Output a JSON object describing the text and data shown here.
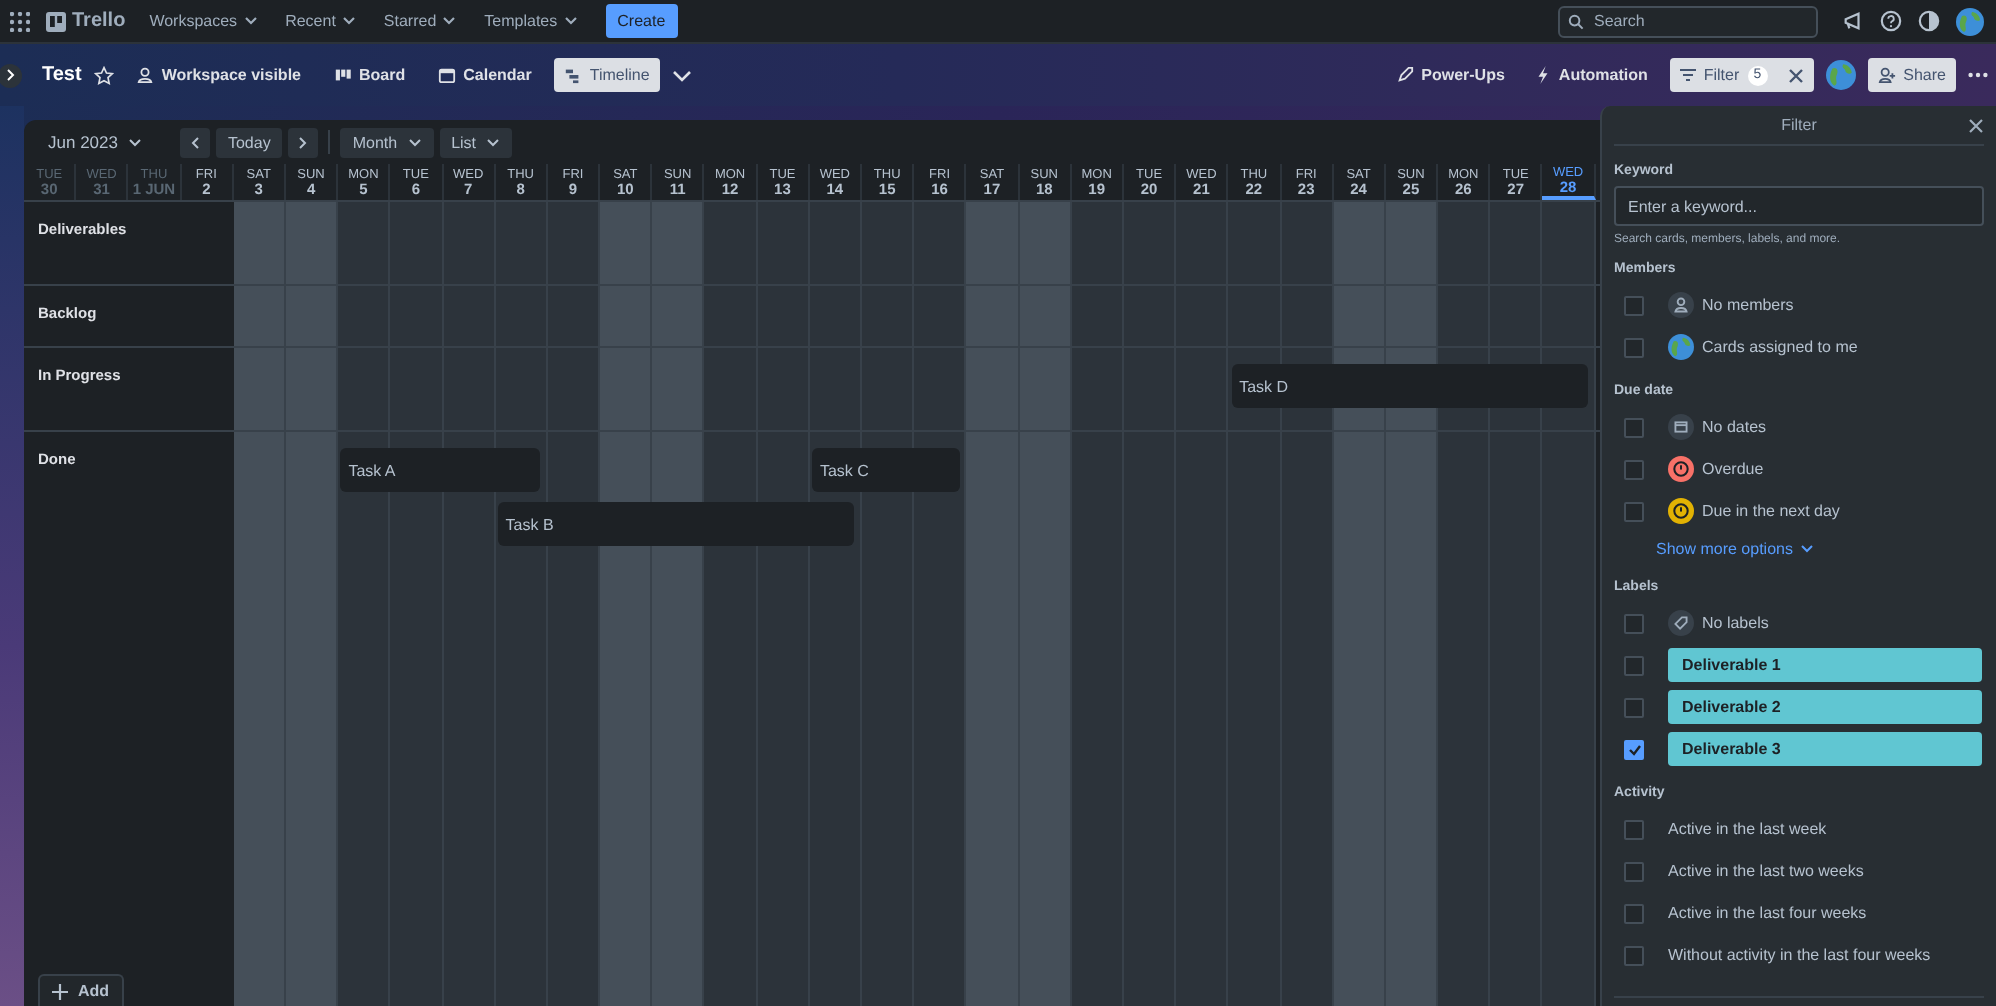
{
  "top_nav": {
    "logo": "Trello",
    "menus": [
      "Workspaces",
      "Recent",
      "Starred",
      "Templates"
    ],
    "create": "Create",
    "search_placeholder": "Search"
  },
  "board_header": {
    "title": "Test",
    "visibility": "Workspace visible",
    "views": [
      {
        "label": "Board",
        "kind": "board",
        "selected": false
      },
      {
        "label": "Calendar",
        "kind": "calendar",
        "selected": false
      },
      {
        "label": "Timeline",
        "kind": "timeline",
        "selected": true
      }
    ],
    "power_ups": "Power-Ups",
    "automation": "Automation",
    "filter": "Filter",
    "filter_count": "5",
    "share": "Share"
  },
  "timeline": {
    "month": "Jun 2023",
    "today": "Today",
    "zoom": "Month",
    "group": "List",
    "days": [
      {
        "dow": "TUE",
        "num": "30",
        "dimmed": true,
        "today": false
      },
      {
        "dow": "WED",
        "num": "31",
        "dimmed": true,
        "today": false
      },
      {
        "dow": "THU",
        "num": "1 JUN",
        "dimmed": true,
        "today": false
      },
      {
        "dow": "FRI",
        "num": "2",
        "dimmed": false,
        "today": false
      },
      {
        "dow": "SAT",
        "num": "3",
        "weekend": true,
        "dimmed": false,
        "today": false
      },
      {
        "dow": "SUN",
        "num": "4",
        "weekend": true,
        "dimmed": false,
        "today": false
      },
      {
        "dow": "MON",
        "num": "5",
        "weekend": false,
        "dimmed": false,
        "today": false
      },
      {
        "dow": "TUE",
        "num": "6",
        "weekend": false,
        "dimmed": false,
        "today": false
      },
      {
        "dow": "WED",
        "num": "7",
        "weekend": false,
        "dimmed": false,
        "today": false
      },
      {
        "dow": "THU",
        "num": "8",
        "weekend": false,
        "dimmed": false,
        "today": false
      },
      {
        "dow": "FRI",
        "num": "9",
        "weekend": false,
        "dimmed": false,
        "today": false
      },
      {
        "dow": "SAT",
        "num": "10",
        "weekend": true,
        "dimmed": false,
        "today": false
      },
      {
        "dow": "SUN",
        "num": "11",
        "weekend": true,
        "dimmed": false,
        "today": false
      },
      {
        "dow": "MON",
        "num": "12",
        "weekend": false,
        "dimmed": false,
        "today": false
      },
      {
        "dow": "TUE",
        "num": "13",
        "weekend": false,
        "dimmed": false,
        "today": false
      },
      {
        "dow": "WED",
        "num": "14",
        "weekend": false,
        "dimmed": false,
        "today": false
      },
      {
        "dow": "THU",
        "num": "15",
        "weekend": false,
        "dimmed": false,
        "today": false
      },
      {
        "dow": "FRI",
        "num": "16",
        "weekend": false,
        "dimmed": false,
        "today": false
      },
      {
        "dow": "SAT",
        "num": "17",
        "weekend": true,
        "dimmed": false,
        "today": false
      },
      {
        "dow": "SUN",
        "num": "18",
        "weekend": true,
        "dimmed": false,
        "today": false
      },
      {
        "dow": "MON",
        "num": "19",
        "weekend": false,
        "dimmed": false,
        "today": false
      },
      {
        "dow": "TUE",
        "num": "20",
        "weekend": false,
        "dimmed": false,
        "today": false
      },
      {
        "dow": "WED",
        "num": "21",
        "weekend": false,
        "dimmed": false,
        "today": false
      },
      {
        "dow": "THU",
        "num": "22",
        "weekend": false,
        "dimmed": false,
        "today": false
      },
      {
        "dow": "FRI",
        "num": "23",
        "weekend": false,
        "dimmed": false,
        "today": false
      },
      {
        "dow": "SAT",
        "num": "24",
        "weekend": true,
        "dimmed": false,
        "today": false
      },
      {
        "dow": "SUN",
        "num": "25",
        "weekend": true,
        "dimmed": false,
        "today": false
      },
      {
        "dow": "MON",
        "num": "26",
        "weekend": false,
        "dimmed": false,
        "today": false
      },
      {
        "dow": "TUE",
        "num": "27",
        "weekend": false,
        "dimmed": false,
        "today": false
      },
      {
        "dow": "WED",
        "num": "28",
        "weekend": false,
        "dimmed": false,
        "today": true
      }
    ],
    "lists": [
      {
        "name": "Deliverables"
      },
      {
        "name": "Backlog"
      },
      {
        "name": "In Progress",
        "tasks": [
          "Task D"
        ]
      },
      {
        "name": "Done",
        "tasks": [
          "Task A",
          "Task B",
          "Task C"
        ]
      }
    ],
    "add": "Add"
  },
  "filter_panel": {
    "title": "Filter",
    "keyword_label": "Keyword",
    "keyword_placeholder": "Enter a keyword...",
    "keyword_hint": "Search cards, members, labels, and more.",
    "sections": [
      {
        "title": "Members",
        "options": [
          {
            "kind": "no-members",
            "label": "No members",
            "checked": false
          },
          {
            "kind": "me",
            "label": "Cards assigned to me",
            "checked": false
          }
        ]
      },
      {
        "title": "Due date",
        "show_more": "Show more options",
        "options": [
          {
            "kind": "no-dates",
            "label": "No dates",
            "checked": false
          },
          {
            "kind": "due",
            "label": "Overdue",
            "checked": false,
            "color": "#f87168"
          },
          {
            "kind": "due",
            "label": "Due in the next day",
            "checked": false,
            "color": "#e2b203"
          }
        ]
      },
      {
        "title": "Labels",
        "options": [
          {
            "kind": "no-labels",
            "label": "No labels",
            "checked": false
          },
          {
            "kind": "label",
            "label": "Deliverable 1",
            "checked": false,
            "color": "#60c6d2"
          },
          {
            "kind": "label",
            "label": "Deliverable 2",
            "checked": false,
            "color": "#60c6d2"
          },
          {
            "kind": "label",
            "label": "Deliverable 3",
            "checked": true,
            "color": "#60c6d2"
          }
        ]
      },
      {
        "title": "Activity",
        "options": [
          {
            "kind": "plain",
            "label": "Active in the last week",
            "checked": false
          },
          {
            "kind": "plain",
            "label": "Active in the last two weeks",
            "checked": false
          },
          {
            "kind": "plain",
            "label": "Active in the last four weeks",
            "checked": false
          },
          {
            "kind": "plain",
            "label": "Without activity in the last four weeks",
            "checked": false
          }
        ]
      }
    ]
  }
}
